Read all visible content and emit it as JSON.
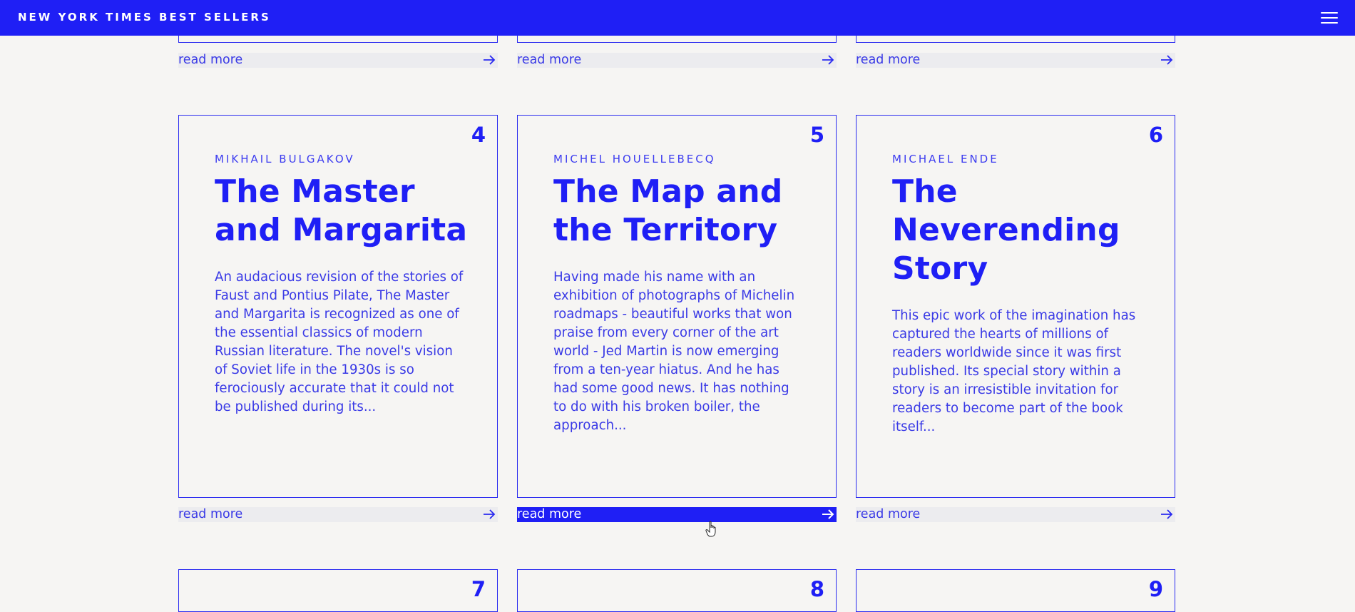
{
  "header": {
    "title": "NEW YORK TIMES BEST SELLERS",
    "menu_icon": "hamburger-menu-icon"
  },
  "read_more_label": "read more",
  "read_more_icon": "arrow-right-icon",
  "cards": [
    {
      "number": "4",
      "author": "MIKHAIL BULGAKOV",
      "title": "The Master and Margarita",
      "description": "An audacious revision of the stories of Faust and Pontius Pilate, The Master and Margarita is recognized as one of the essential classics of modern Russian literature. The novel's vision of Soviet life in the 1930s is so ferociously accurate that it could not be published during its..."
    },
    {
      "number": "5",
      "author": "MICHEL HOUELLEBECQ",
      "title": "The Map and the Territory",
      "description": "Having made his name with an exhibition of photographs of Michelin roadmaps - beautiful works that won praise from every corner of the art world - Jed Martin is now emerging from a ten-year hiatus. And he has had some good news. It has nothing to do with his broken boiler, the approach..."
    },
    {
      "number": "6",
      "author": "MICHAEL ENDE",
      "title": "The Neverending Story",
      "description": "This epic work of the imagination has captured the hearts of millions of readers worldwide since it was first published. Its special story within a story is an irresistible invitation for readers to become part of the book itself..."
    }
  ],
  "next_row_numbers": [
    "7",
    "8",
    "9"
  ],
  "colors": {
    "accent": "#1f1ff5",
    "background": "#f6f5f3",
    "read_more_bg": "#ececef"
  }
}
